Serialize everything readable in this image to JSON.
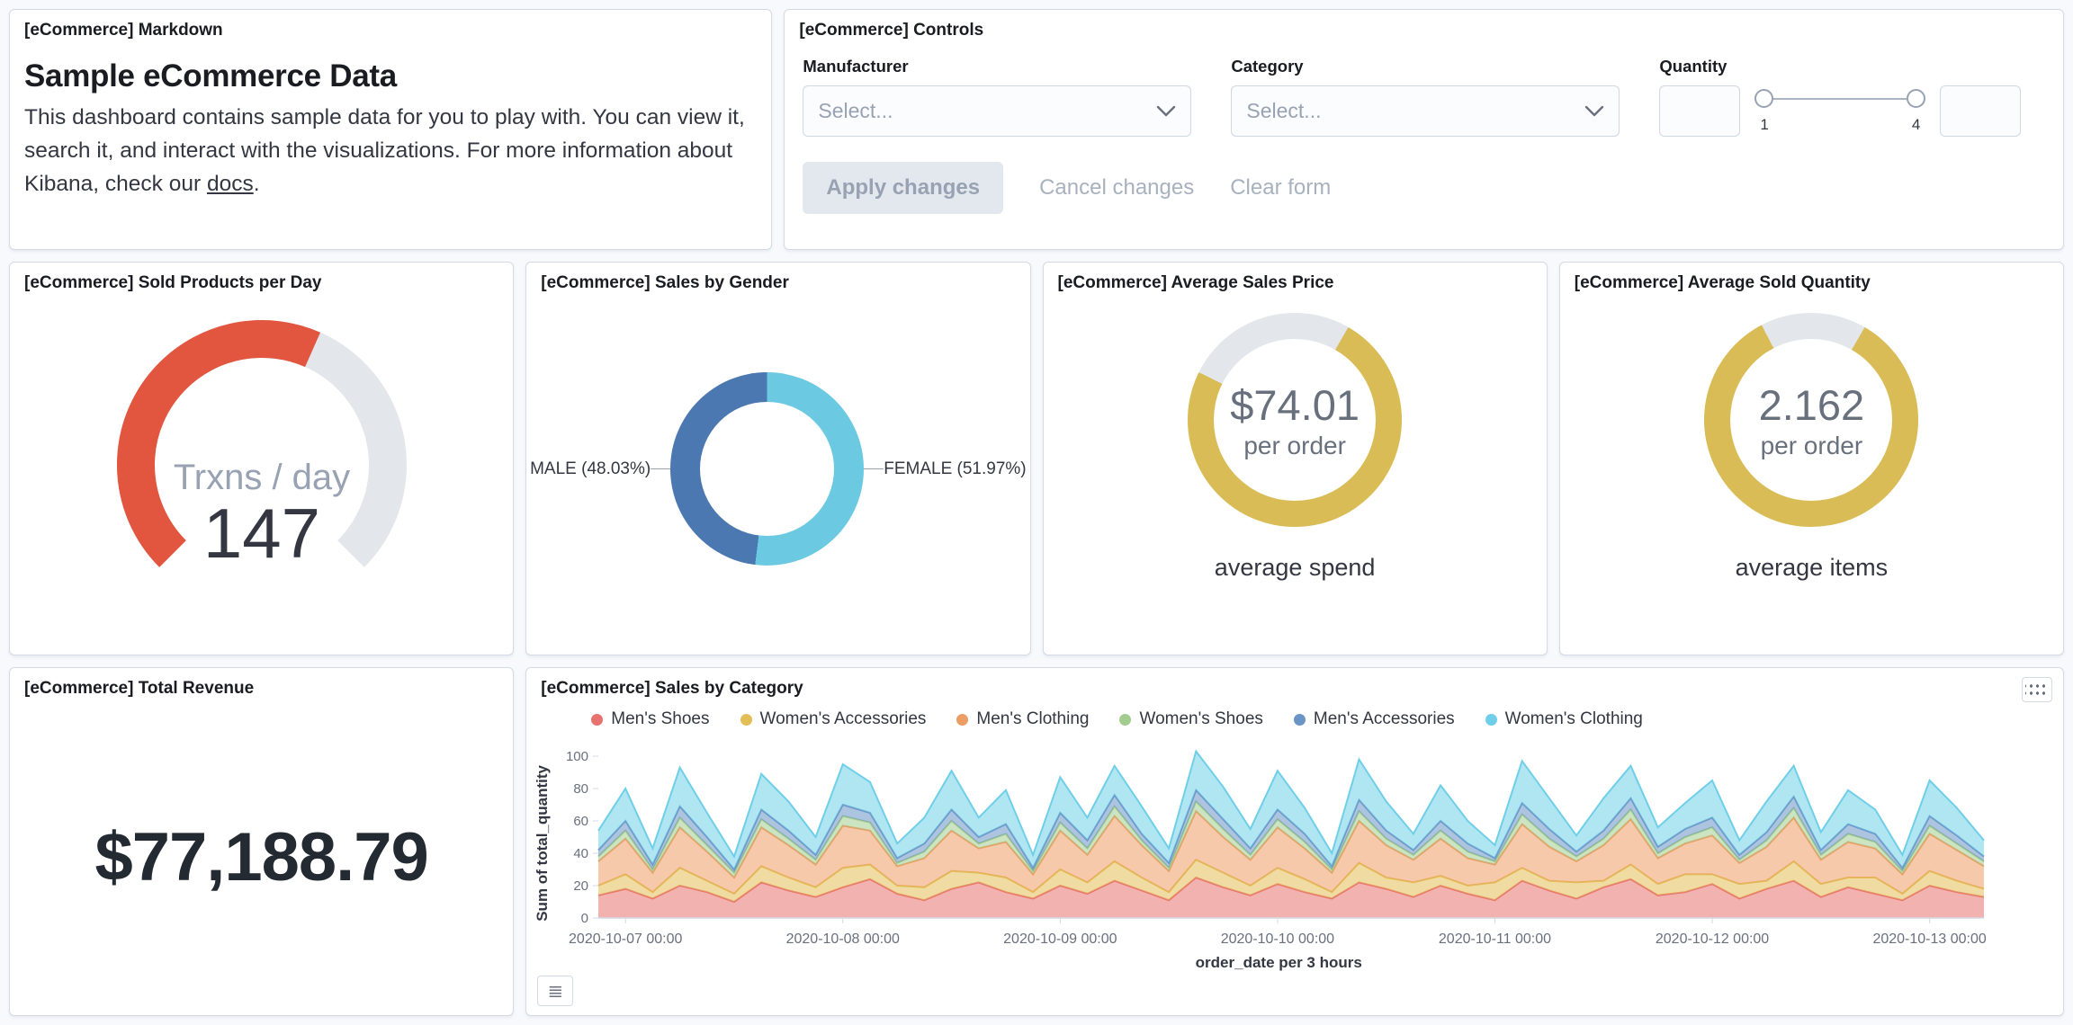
{
  "markdown_panel": {
    "title": "[eCommerce] Markdown",
    "heading": "Sample eCommerce Data",
    "body_before": "This dashboard contains sample data for you to play with. You can view it, search it, and interact with the visualizations. For more information about Kibana, check our ",
    "link_text": "docs",
    "body_after": "."
  },
  "controls_panel": {
    "title": "[eCommerce] Controls",
    "manufacturer": {
      "label": "Manufacturer",
      "placeholder": "Select..."
    },
    "category": {
      "label": "Category",
      "placeholder": "Select..."
    },
    "quantity": {
      "label": "Quantity",
      "min_label": "1",
      "max_label": "4"
    },
    "buttons": {
      "apply": "Apply changes",
      "cancel": "Cancel changes",
      "clear": "Clear form"
    }
  },
  "gauge_panel": {
    "title": "[eCommerce] Sold Products per Day",
    "chart_data": {
      "type": "gauge",
      "label": "Trxns / day",
      "value": 147,
      "min": 0,
      "max": 250,
      "arc_degrees": 270,
      "color": "#E2563F",
      "track": "#E3E6EA"
    }
  },
  "gender_panel": {
    "title": "[eCommerce] Sales by Gender",
    "chart_data": {
      "type": "pie",
      "slices": [
        {
          "label": "MALE",
          "percent": 48.03,
          "display": "MALE (48.03%)",
          "color": "#4C78B1"
        },
        {
          "label": "FEMALE",
          "percent": 51.97,
          "display": "FEMALE (51.97%)",
          "color": "#6CC9E2"
        }
      ]
    }
  },
  "price_panel": {
    "title": "[eCommerce] Average Sales Price",
    "chart_data": {
      "type": "goal",
      "value": "$74.01",
      "sublabel": "per order",
      "caption": "average spend",
      "fraction": 0.74,
      "color": "#D9BC55",
      "track": "#E3E6EA"
    }
  },
  "quantity_panel": {
    "title": "[eCommerce] Average Sold Quantity",
    "chart_data": {
      "type": "goal",
      "value": "2.162",
      "sublabel": "per order",
      "caption": "average items",
      "fraction": 0.84,
      "color": "#D9BC55",
      "track": "#E3E6EA"
    }
  },
  "revenue_panel": {
    "title": "[eCommerce] Total Revenue",
    "chart_data": {
      "type": "metric",
      "value": "$77,188.79"
    }
  },
  "category_panel": {
    "title": "[eCommerce] Sales by Category",
    "chart_data": {
      "type": "area",
      "stacked": true,
      "title": "[eCommerce] Sales by Category",
      "xlabel": "order_date per 3 hours",
      "ylabel": "Sum of total_quantity",
      "ylim": [
        0,
        100
      ],
      "yticks": [
        0,
        20,
        40,
        60,
        80,
        100
      ],
      "x_start": "2020-10-06 21:00",
      "x_interval_hours": 3,
      "x_tick_labels": [
        "2020-10-07 00:00",
        "2020-10-08 00:00",
        "2020-10-09 00:00",
        "2020-10-10 00:00",
        "2020-10-11 00:00",
        "2020-10-12 00:00",
        "2020-10-13 00:00"
      ],
      "x_tick_indices": [
        1,
        9,
        17,
        25,
        33,
        41,
        49
      ],
      "legend_position": "top",
      "grid": false,
      "series": [
        {
          "name": "Men's Shoes",
          "color": "#E8726D",
          "values": [
            14,
            18,
            12,
            20,
            16,
            10,
            22,
            17,
            13,
            19,
            24,
            15,
            11,
            18,
            22,
            16,
            12,
            20,
            15,
            23,
            17,
            11,
            25,
            19,
            14,
            21,
            16,
            12,
            22,
            18,
            13,
            20,
            15,
            11,
            23,
            17,
            12,
            19,
            24,
            14,
            16,
            21,
            12,
            18,
            23,
            13,
            19,
            15,
            11,
            20,
            16,
            13
          ]
        },
        {
          "name": "Women's Accessories",
          "color": "#E3BE57",
          "values": [
            6,
            9,
            4,
            11,
            7,
            5,
            10,
            8,
            6,
            12,
            9,
            5,
            8,
            11,
            6,
            9,
            4,
            10,
            7,
            12,
            8,
            5,
            11,
            9,
            6,
            10,
            8,
            4,
            12,
            7,
            9,
            6,
            5,
            11,
            8,
            6,
            10,
            4,
            9,
            7,
            11,
            6,
            9,
            5,
            12,
            8,
            6,
            10,
            4,
            9,
            7,
            5
          ]
        },
        {
          "name": "Men's Clothing",
          "color": "#EC9D63",
          "values": [
            15,
            22,
            12,
            25,
            18,
            10,
            24,
            20,
            14,
            26,
            21,
            12,
            18,
            25,
            15,
            22,
            11,
            24,
            17,
            28,
            20,
            13,
            30,
            22,
            16,
            25,
            19,
            12,
            26,
            20,
            14,
            23,
            17,
            11,
            27,
            21,
            13,
            22,
            28,
            16,
            19,
            24,
            13,
            21,
            27,
            15,
            22,
            18,
            12,
            23,
            19,
            14
          ]
        },
        {
          "name": "Women's Shoes",
          "color": "#A3CD8F",
          "values": [
            3,
            5,
            2,
            6,
            4,
            3,
            5,
            4,
            3,
            6,
            5,
            2,
            4,
            6,
            3,
            5,
            2,
            5,
            4,
            6,
            3,
            2,
            6,
            5,
            3,
            5,
            4,
            2,
            6,
            4,
            3,
            5,
            4,
            2,
            6,
            5,
            3,
            4,
            6,
            3,
            4,
            5,
            2,
            4,
            6,
            3,
            5,
            4,
            2,
            5,
            4,
            3
          ]
        },
        {
          "name": "Men's Accessories",
          "color": "#6A93C6",
          "values": [
            4,
            6,
            3,
            7,
            5,
            2,
            6,
            5,
            3,
            7,
            6,
            3,
            5,
            7,
            4,
            6,
            2,
            6,
            5,
            7,
            4,
            3,
            7,
            6,
            4,
            6,
            5,
            2,
            7,
            5,
            3,
            6,
            5,
            2,
            7,
            6,
            3,
            5,
            7,
            4,
            5,
            6,
            3,
            5,
            7,
            3,
            6,
            5,
            2,
            6,
            5,
            3
          ]
        },
        {
          "name": "Women's Clothing",
          "color": "#6FCFE8",
          "values": [
            12,
            20,
            10,
            24,
            15,
            8,
            22,
            18,
            11,
            25,
            19,
            9,
            16,
            24,
            12,
            21,
            8,
            22,
            14,
            18,
            17,
            9,
            24,
            20,
            12,
            24,
            16,
            8,
            25,
            18,
            10,
            22,
            14,
            8,
            26,
            19,
            10,
            20,
            20,
            12,
            16,
            23,
            9,
            19,
            19,
            11,
            21,
            15,
            8,
            22,
            17,
            10
          ]
        }
      ]
    }
  }
}
